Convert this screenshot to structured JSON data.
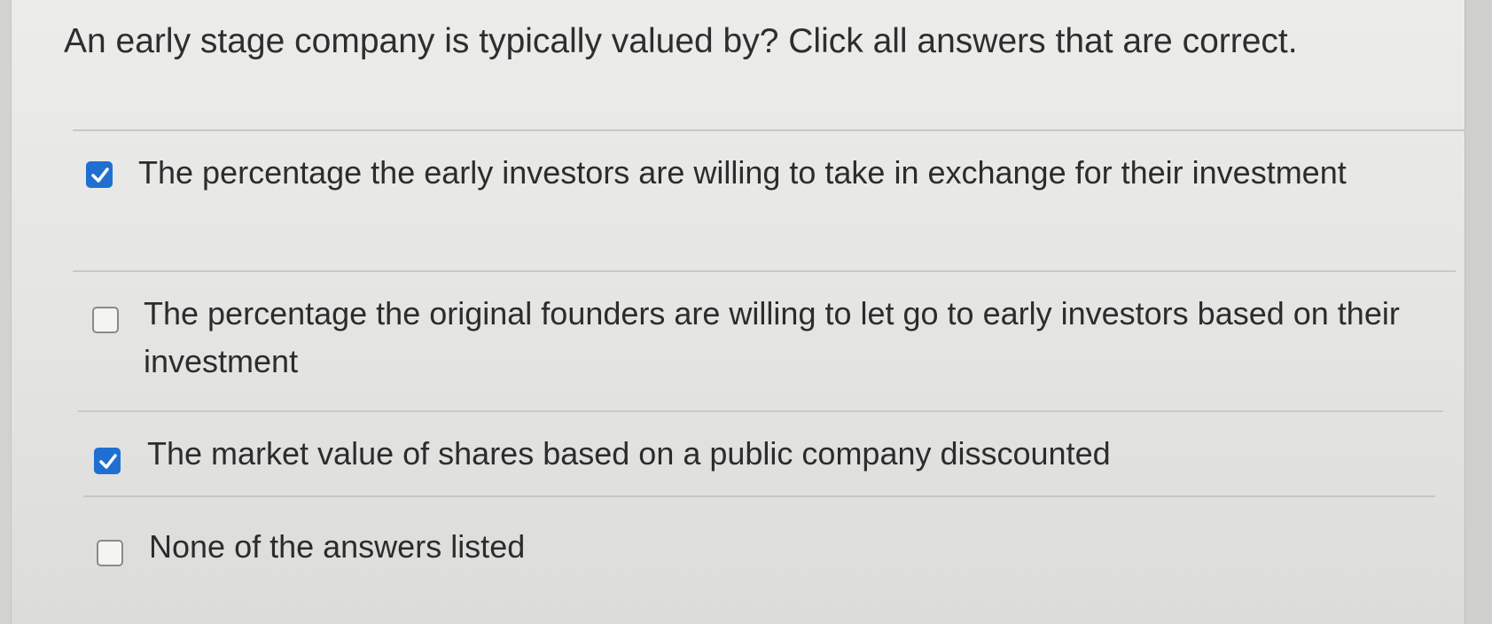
{
  "question": {
    "text": "An early stage company is typically valued by? Click all answers that are correct."
  },
  "options": [
    {
      "label": "The percentage the early investors are willing to take in exchange for their investment",
      "checked": true
    },
    {
      "label": "The percentage the original founders are willing to let go to early investors based on their investment",
      "checked": false
    },
    {
      "label": "The market value of shares based on a public company disscounted",
      "checked": true
    },
    {
      "label": "None of the answers listed",
      "checked": false
    }
  ],
  "colors": {
    "checkbox_checked": "#1f6fd1",
    "checkbox_border": "#8a8a8a",
    "background": "#e6e6e4"
  }
}
